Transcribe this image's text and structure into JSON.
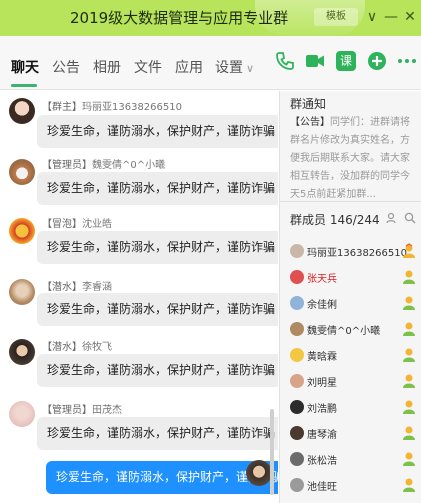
{
  "window": {
    "title": "2019级大数据管理与应用专业群",
    "tag_label": "模板",
    "buttons": {
      "dropdown": "∨",
      "minimize": "—",
      "close": "✕"
    }
  },
  "tabs": [
    {
      "label": "聊天",
      "active": true
    },
    {
      "label": "公告"
    },
    {
      "label": "相册"
    },
    {
      "label": "文件"
    },
    {
      "label": "应用"
    },
    {
      "label": "设置",
      "suffix": "∨"
    }
  ],
  "toolbar_icons": [
    "phone-icon",
    "video-icon",
    "homework-icon",
    "add-icon",
    "more-icon"
  ],
  "homework_label": "课",
  "colors": {
    "titlebar": "#b7e45b",
    "accent": "#3cb371",
    "my_bubble": "#1e90ff",
    "owner_name": "#e02020"
  },
  "messages": [
    {
      "role": "【群主】",
      "sender": "玛丽亚13638266510",
      "text": "珍爱生命，谨防溺水，保护财产，谨防诈骗"
    },
    {
      "role": "【管理员】",
      "sender": "魏雯倩^0^小曦",
      "text": "珍爱生命，谨防溺水，保护财产，谨防诈骗"
    },
    {
      "role": "【冒泡】",
      "sender": "沈业皓",
      "text": "珍爱生命，谨防溺水，保护财产，谨防诈骗"
    },
    {
      "role": "【潜水】",
      "sender": "李睿涵",
      "text": "珍爱生命，谨防溺水，保护财产，谨防诈骗"
    },
    {
      "role": "【潜水】",
      "sender": "徐牧飞",
      "text": "珍爱生命，谨防溺水，保护财产，谨防诈骗"
    },
    {
      "role": "【管理员】",
      "sender": "田茂杰",
      "text": "珍爱生命，谨防溺水，保护财产，谨防诈骗"
    },
    {
      "role": "",
      "sender": "",
      "text": "珍爱生命，谨防溺水，保护财产，谨防诈骗",
      "mine": true
    }
  ],
  "notice": {
    "title": "群通知",
    "tag": "【公告】",
    "body": "同学们：进群请将群名片修改为真实姓名，方便我后期联系大家。请大家相互转告，没加群的同学今天5点前赶紧加群..."
  },
  "members": {
    "title": "群成员 146/244",
    "list": [
      {
        "name": "玛丽亚13638266510",
        "badge": "owner-icon"
      },
      {
        "name": "张天兵",
        "highlight": true,
        "badge": "admin-icon"
      },
      {
        "name": "余佳俐",
        "badge": "admin-icon"
      },
      {
        "name": "魏雯倩^0^小曦",
        "badge": "admin-icon"
      },
      {
        "name": "黄晗霖",
        "badge": "admin-icon"
      },
      {
        "name": "刘明星",
        "badge": "admin-icon"
      },
      {
        "name": "刘浩鹏",
        "badge": "admin-icon"
      },
      {
        "name": "唐琴渝",
        "badge": "admin-icon"
      },
      {
        "name": "张松浩",
        "badge": "admin-icon"
      },
      {
        "name": "池佳旺",
        "badge": "admin-icon"
      }
    ]
  }
}
